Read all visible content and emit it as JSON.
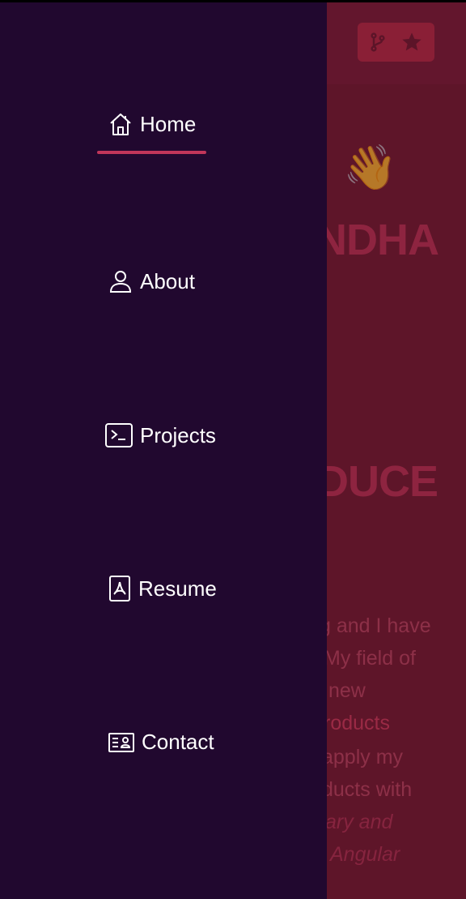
{
  "drawer": {
    "items": [
      {
        "label": "Home",
        "icon": "home-icon",
        "active": true
      },
      {
        "label": "About",
        "icon": "person-icon"
      },
      {
        "label": "Projects",
        "icon": "terminal-icon"
      },
      {
        "label": "Resume",
        "icon": "pdf-file-icon"
      },
      {
        "label": "Contact",
        "icon": "contact-card-icon"
      }
    ],
    "active_color": "#c1365a",
    "background": "#21082f"
  },
  "background_page": {
    "header": {
      "github_icon": "git-fork-icon",
      "star_icon": "star-icon"
    },
    "greeting": "!",
    "wave_emoji": "👋",
    "name_fragment": "NDHA",
    "heading_fragment": "DUCE",
    "paragraph_lines": [
      "g and I have",
      "My field of",
      "new",
      "roducts",
      "apply my",
      "ducts with",
      "ary and",
      "Angular"
    ]
  }
}
